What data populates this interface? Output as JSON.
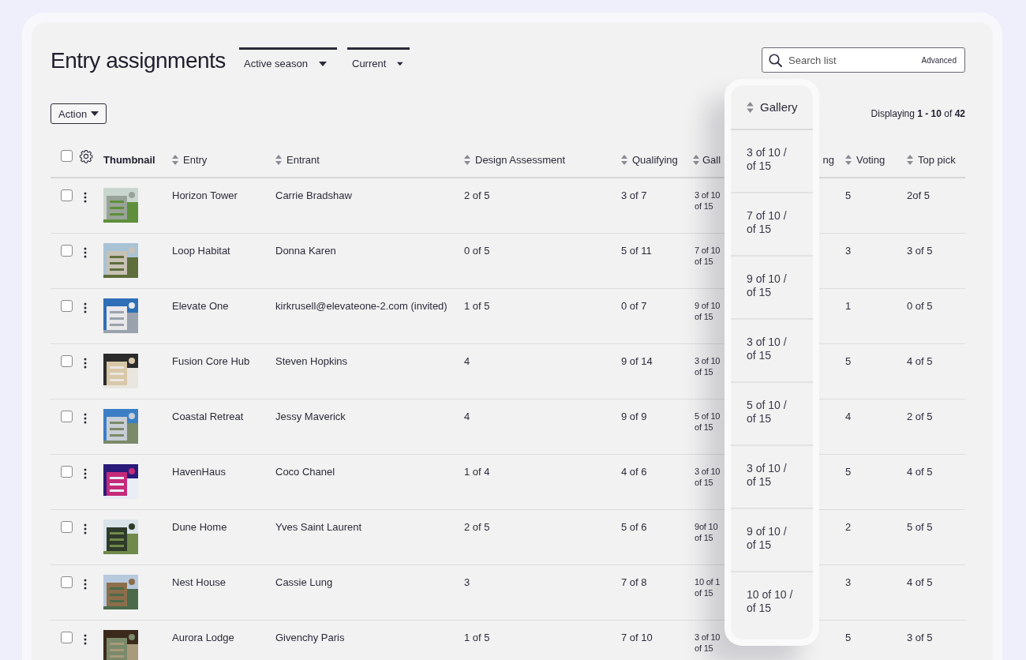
{
  "title": "Entry assignments",
  "filters": [
    {
      "label": "Active season"
    },
    {
      "label": "Current"
    }
  ],
  "search": {
    "placeholder": "Search list",
    "advanced": "Advanced"
  },
  "action": "Action",
  "displaying": "Displaying **1 - 10** of **42**",
  "header_checkbox": {
    "checked": false
  },
  "columns": [
    {
      "label": "Thumbnail",
      "kind": "plain"
    },
    {
      "label": "Entry",
      "kind": "sortable"
    },
    {
      "label": "Entrant",
      "kind": "sortable"
    },
    {
      "label": "Design Assessment",
      "kind": "sortable"
    },
    {
      "label": "Qualifying",
      "kind": "sortable"
    },
    {
      "label": "Gall",
      "kind": "sortable"
    },
    {
      "label": "ng",
      "kind": "hidden"
    },
    {
      "label": "Voting",
      "kind": "sortable"
    },
    {
      "label": "Top pick",
      "kind": "sortable"
    }
  ],
  "rows": [
    {
      "checked": false,
      "entry": "Horizon Tower",
      "entrant": "Carrie Bradshaw",
      "design": "2 of 5",
      "qualifying": "3 of 7",
      "gallery": [
        "3 of 10",
        "of 15"
      ],
      "voting": "5",
      "top_pick": "2of 5"
    },
    {
      "checked": false,
      "entry": "Loop Habitat",
      "entrant": "Donna Karen",
      "design": "0 of 5",
      "qualifying": "5 of 11",
      "gallery": [
        "7 of 10",
        "of 15"
      ],
      "voting": "3",
      "top_pick": "3 of 5"
    },
    {
      "checked": false,
      "entry": "Elevate One",
      "entrant": "kirkrusell@elevateone-2.com (invited)",
      "design": "1 of 5",
      "qualifying": "0 of 7",
      "gallery": [
        "9 of 10",
        "of 15"
      ],
      "voting": "1",
      "top_pick": "0 of 5"
    },
    {
      "checked": false,
      "entry": "Fusion Core Hub",
      "entrant": "Steven Hopkins",
      "design": "4",
      "qualifying": "9 of 14",
      "gallery": [
        "3 of 10",
        "of 15"
      ],
      "voting": "5",
      "top_pick": "4 of 5"
    },
    {
      "checked": false,
      "entry": "Coastal Retreat",
      "entrant": "Jessy Maverick",
      "design": "4",
      "qualifying": "9 of 9",
      "gallery": [
        "5 of 10",
        "of 15"
      ],
      "voting": "4",
      "top_pick": "2 of 5"
    },
    {
      "checked": false,
      "entry": "HavenHaus",
      "entrant": "Coco Chanel",
      "design": "1 of 4",
      "qualifying": "4 of 6",
      "gallery": [
        "3 of 10",
        "of 15"
      ],
      "voting": "5",
      "top_pick": "4 of 5"
    },
    {
      "checked": false,
      "entry": "Dune Home",
      "entrant": "Yves Saint Laurent",
      "design": "2 of 5",
      "qualifying": "5 of 6",
      "gallery": [
        "9of 10",
        "of 15"
      ],
      "voting": "2",
      "top_pick": "5 of 5"
    },
    {
      "checked": false,
      "entry": "Nest House",
      "entrant": "Cassie Lung",
      "design": "3",
      "qualifying": "7 of 8",
      "gallery": [
        "10 of 1",
        "of 15"
      ],
      "voting": "3",
      "top_pick": "4 of 5"
    },
    {
      "checked": false,
      "entry": "Aurora Lodge",
      "entrant": "Givenchy Paris",
      "design": "1 of 5",
      "qualifying": "7 of 10",
      "gallery": [
        "3 of 10",
        "of 15"
      ],
      "voting": "5",
      "top_pick": "3 of 5"
    }
  ],
  "gallery_overlay": {
    "header": "Gallery",
    "cells": [
      [
        "3 of 10 /",
        "of 15"
      ],
      [
        "7 of 10 /",
        "of 15"
      ],
      [
        "9 of 10 /",
        "of 15"
      ],
      [
        "3 of 10 /",
        "of 15"
      ],
      [
        "5 of 10 /",
        "of 15"
      ],
      [
        "3 of 10 /",
        "of 15"
      ],
      [
        "9 of 10 /",
        "of 15"
      ],
      [
        "10 of 10 /",
        "of 15"
      ]
    ]
  }
}
